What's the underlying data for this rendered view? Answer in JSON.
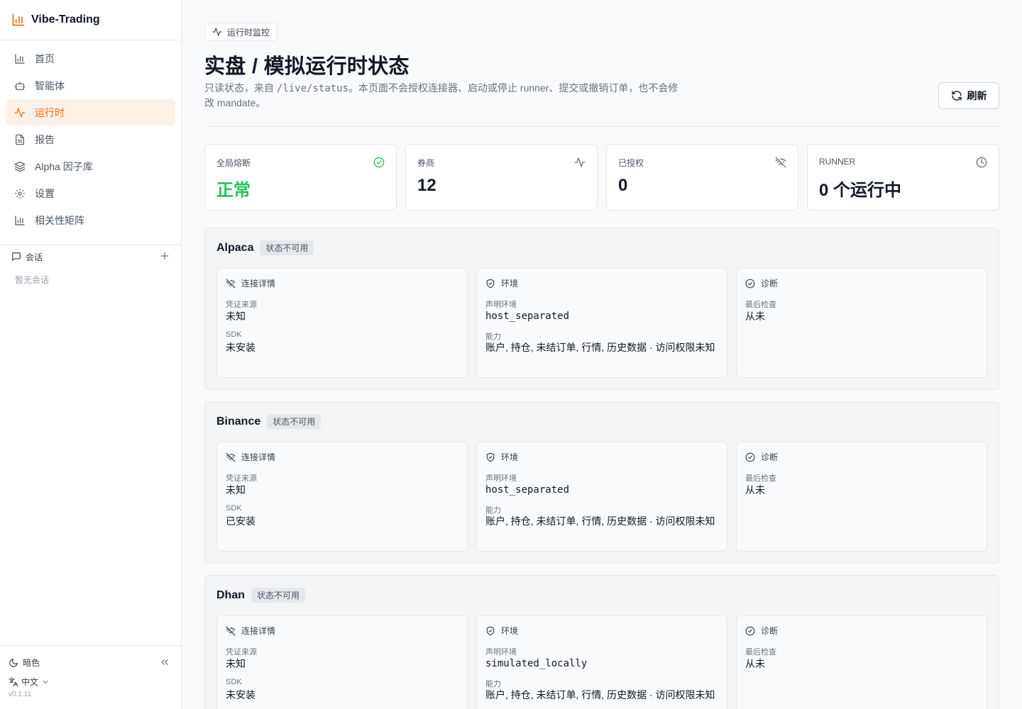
{
  "brand": {
    "title": "Vibe-Trading",
    "accent": "#ea6c0a"
  },
  "nav": [
    {
      "label": "首页",
      "icon": "bar-chart-icon"
    },
    {
      "label": "智能体",
      "icon": "bot-icon"
    },
    {
      "label": "运行时",
      "icon": "activity-icon",
      "active": true
    },
    {
      "label": "报告",
      "icon": "file-text-icon"
    },
    {
      "label": "Alpha 因子库",
      "icon": "layers-icon"
    },
    {
      "label": "设置",
      "icon": "gear-icon"
    },
    {
      "label": "相关性矩阵",
      "icon": "bar-chart-icon"
    }
  ],
  "sessions": {
    "title": "会话",
    "empty": "暂无会话"
  },
  "footer": {
    "theme": "暗色",
    "language": "中文",
    "version": "v0.1.11"
  },
  "header": {
    "chip": "运行时监控",
    "title": "实盘 / 模拟运行时状态",
    "desc_pre": "只读状态，来自 ",
    "desc_code": "/live/status",
    "desc_post": "。本页面不会授权连接器、启动或停止 runner、提交或撤销订单，也不会修改 mandate。",
    "refresh": "刷新"
  },
  "stats": [
    {
      "label": "全局熔断",
      "value": "正常",
      "status_color": "#22c55e"
    },
    {
      "label": "券商",
      "value": "12"
    },
    {
      "label": "已授权",
      "value": "0"
    },
    {
      "label": "RUNNER",
      "value": "0 个运行中"
    }
  ],
  "panel_titles": {
    "connection": "连接详情",
    "environment": "环境",
    "diagnostics": "诊断"
  },
  "field_labels": {
    "credential": "凭证来源",
    "sdk": "SDK",
    "declared_env": "声明环境",
    "capabilities": "能力",
    "last_check": "最后检查"
  },
  "brokers": [
    {
      "name": "Alpaca",
      "badge": "状态不可用",
      "credential": "未知",
      "sdk": "未安装",
      "env": "host_separated",
      "capabilities": "账户, 持仓, 未结订单, 行情, 历史数据 · 访问权限未知",
      "last_check": "从未"
    },
    {
      "name": "Binance",
      "badge": "状态不可用",
      "credential": "未知",
      "sdk": "已安装",
      "env": "host_separated",
      "capabilities": "账户, 持仓, 未结订单, 行情, 历史数据 · 访问权限未知",
      "last_check": "从未"
    },
    {
      "name": "Dhan",
      "badge": "状态不可用",
      "credential": "未知",
      "sdk": "未安装",
      "env": "simulated_locally",
      "capabilities": "账户, 持仓, 未结订单, 行情, 历史数据 · 访问权限未知",
      "last_check": "从未"
    }
  ]
}
